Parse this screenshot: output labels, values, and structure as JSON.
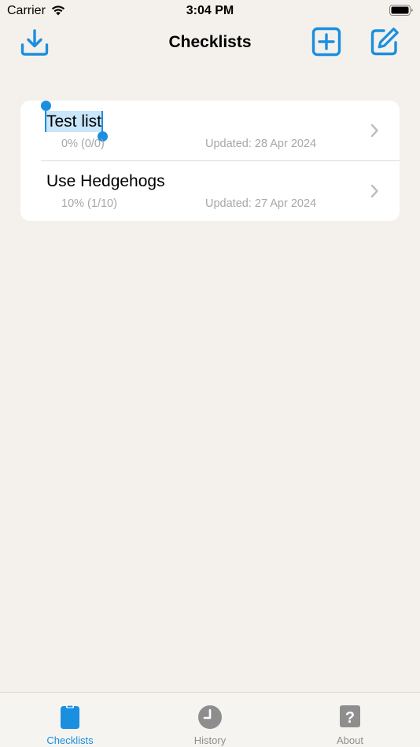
{
  "status_bar": {
    "carrier": "Carrier",
    "time": "3:04 PM"
  },
  "nav": {
    "title": "Checklists",
    "icons": [
      "import-icon",
      "add-icon",
      "edit-icon"
    ]
  },
  "checklists": [
    {
      "title": "Test list",
      "progress": "0% (0/0)",
      "updated": "Updated: 28 Apr 2024",
      "selected_text": true
    },
    {
      "title": "Use Hedgehogs",
      "progress": "10% (1/10)",
      "updated": "Updated: 27 Apr 2024",
      "selected_text": false
    }
  ],
  "tabs": [
    {
      "label": "Checklists",
      "icon": "clipboard-icon",
      "active": true
    },
    {
      "label": "History",
      "icon": "clock-icon",
      "active": false
    },
    {
      "label": "About",
      "icon": "question-icon",
      "active": false
    }
  ],
  "colors": {
    "accent": "#1a8fe0",
    "background": "#f4f1ec",
    "card": "#ffffff",
    "secondary_text": "#a7a7a7",
    "inactive_tab": "#8e8e8e"
  }
}
